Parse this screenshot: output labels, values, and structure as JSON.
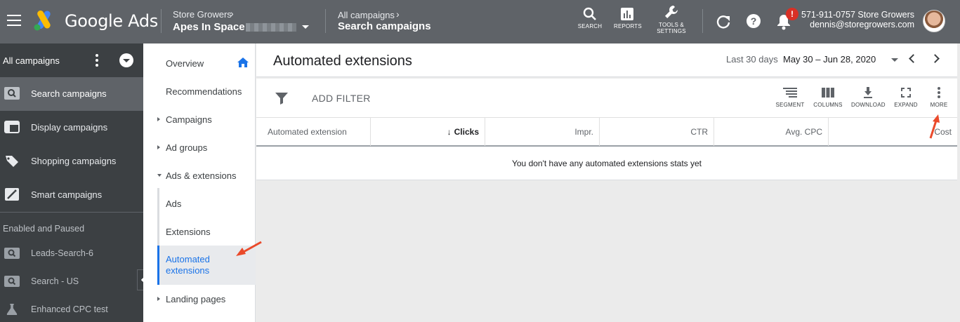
{
  "topbar": {
    "brand": "Google Ads",
    "account_crumb": "Store Growers",
    "account_name": "Apes In Space",
    "campaign_crumb": "All campaigns",
    "campaign_name": "Search campaigns",
    "tools": [
      {
        "label": "SEARCH",
        "icon": "search-icon"
      },
      {
        "label": "REPORTS",
        "icon": "reports-icon"
      },
      {
        "label": "TOOLS &",
        "label2": "SETTINGS",
        "icon": "wrench-icon"
      }
    ],
    "notification_badge": "!",
    "account_phone": "571-911-0757 Store Growers",
    "account_email": "dennis@storegrowers.com"
  },
  "sidebar": {
    "all_campaigns": "All campaigns",
    "items": [
      {
        "label": "Search campaigns",
        "icon": "search-campaign-icon",
        "active": true
      },
      {
        "label": "Display campaigns",
        "icon": "display-campaign-icon"
      },
      {
        "label": "Shopping campaigns",
        "icon": "shopping-tag-icon"
      },
      {
        "label": "Smart campaigns",
        "icon": "smart-wand-icon"
      }
    ],
    "section_label": "Enabled and Paused",
    "campaigns": [
      {
        "label": "Leads-Search-6",
        "icon": "search-campaign-icon"
      },
      {
        "label": "Search - US",
        "icon": "search-campaign-icon"
      },
      {
        "label": "Enhanced CPC test",
        "icon": "experiment-flask-icon"
      }
    ]
  },
  "page_menu": {
    "overview": "Overview",
    "recommendations": "Recommendations",
    "campaigns": "Campaigns",
    "ad_groups": "Ad groups",
    "ads_extensions": "Ads & extensions",
    "ads": "Ads",
    "extensions": "Extensions",
    "automated_line1": "Automated",
    "automated_line2": "extensions",
    "landing_pages": "Landing pages"
  },
  "main": {
    "title": "Automated extensions",
    "date_label": "Last 30 days",
    "date_range": "May 30 – Jun 28, 2020",
    "add_filter": "ADD FILTER",
    "toolbar": [
      {
        "label": "SEGMENT",
        "icon": "segment-icon"
      },
      {
        "label": "COLUMNS",
        "icon": "columns-icon"
      },
      {
        "label": "DOWNLOAD",
        "icon": "download-icon"
      },
      {
        "label": "EXPAND",
        "icon": "expand-icon"
      },
      {
        "label": "MORE",
        "icon": "more-vert-icon"
      }
    ],
    "columns": [
      "Automated extension",
      "Clicks",
      "Impr.",
      "CTR",
      "Avg. CPC",
      "Cost"
    ],
    "empty_message": "You don't have any automated extensions stats yet"
  },
  "colors": {
    "topbar": "#5f6368",
    "sidebar": "#3c4043",
    "accent_blue": "#1a73e8",
    "annotation_arrow": "#ea4a2b"
  }
}
